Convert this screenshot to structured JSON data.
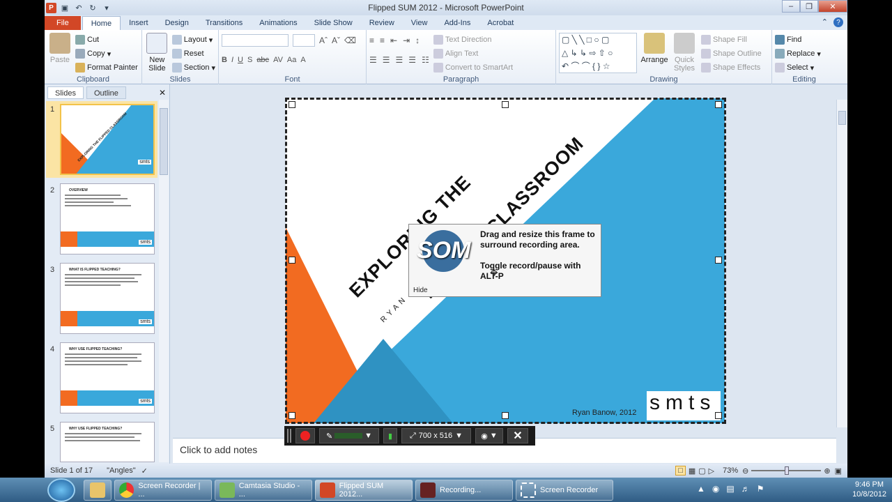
{
  "window": {
    "title": "Flipped SUM 2012 - Microsoft PowerPoint"
  },
  "tabs": {
    "file": "File",
    "home": "Home",
    "insert": "Insert",
    "design": "Design",
    "transitions": "Transitions",
    "animations": "Animations",
    "slideshow": "Slide Show",
    "review": "Review",
    "view": "View",
    "addins": "Add-Ins",
    "acrobat": "Acrobat"
  },
  "ribbon": {
    "clipboard": {
      "label": "Clipboard",
      "paste": "Paste",
      "cut": "Cut",
      "copy": "Copy",
      "painter": "Format Painter"
    },
    "slides": {
      "label": "Slides",
      "new_slide_1": "New",
      "new_slide_2": "Slide",
      "layout": "Layout",
      "reset": "Reset",
      "section": "Section"
    },
    "font": {
      "label": "Font"
    },
    "paragraph": {
      "label": "Paragraph",
      "text_direction": "Text Direction",
      "align_text": "Align Text",
      "convert": "Convert to SmartArt"
    },
    "drawing": {
      "label": "Drawing",
      "arrange": "Arrange",
      "quick_styles_1": "Quick",
      "quick_styles_2": "Styles",
      "shape_fill": "Shape Fill",
      "shape_outline": "Shape Outline",
      "shape_effects": "Shape Effects"
    },
    "editing": {
      "label": "Editing",
      "find": "Find",
      "replace": "Replace",
      "select": "Select"
    }
  },
  "panel": {
    "tab_slides": "Slides",
    "tab_outline": "Outline"
  },
  "thumbnails": [
    {
      "num": "1",
      "title": "EXPLORING THE FLIPPED CLASSROOM"
    },
    {
      "num": "2",
      "title": "OVERVIEW"
    },
    {
      "num": "3",
      "title": "WHAT IS FLIPPED TEACHING?"
    },
    {
      "num": "4",
      "title": "WHY USE FLIPPED TEACHING?"
    },
    {
      "num": "5",
      "title": "WHY USE FLIPPED TEACHING?"
    }
  ],
  "slide": {
    "title_line1": "EXPLORING THE",
    "title_line2": "FLIPPED CLASSROOM",
    "subtitle": "RYAN BANOW",
    "footer": "Ryan Banow, 2012",
    "logo": "smts"
  },
  "recorder": {
    "logo": "SOM",
    "msg1": "Drag and resize this frame to surround recording area.",
    "msg2": "Toggle record/pause with ALT-P",
    "hide": "Hide",
    "size": "700 x 516"
  },
  "notes": {
    "placeholder": "Click to add notes"
  },
  "status": {
    "slide": "Slide 1 of 17",
    "theme": "\"Angles\"",
    "zoom": "73%"
  },
  "taskbar": {
    "items": [
      "Screen Recorder | ...",
      "Camtasia Studio - ...",
      "Flipped SUM 2012...",
      "Recording...",
      "Screen Recorder"
    ],
    "time": "9:46 PM",
    "date": "10/8/2012"
  },
  "colors": {
    "orange": "#f26b21",
    "blue": "#3aa8db",
    "darkblue": "#2d8dba",
    "accent": "#d24726"
  }
}
